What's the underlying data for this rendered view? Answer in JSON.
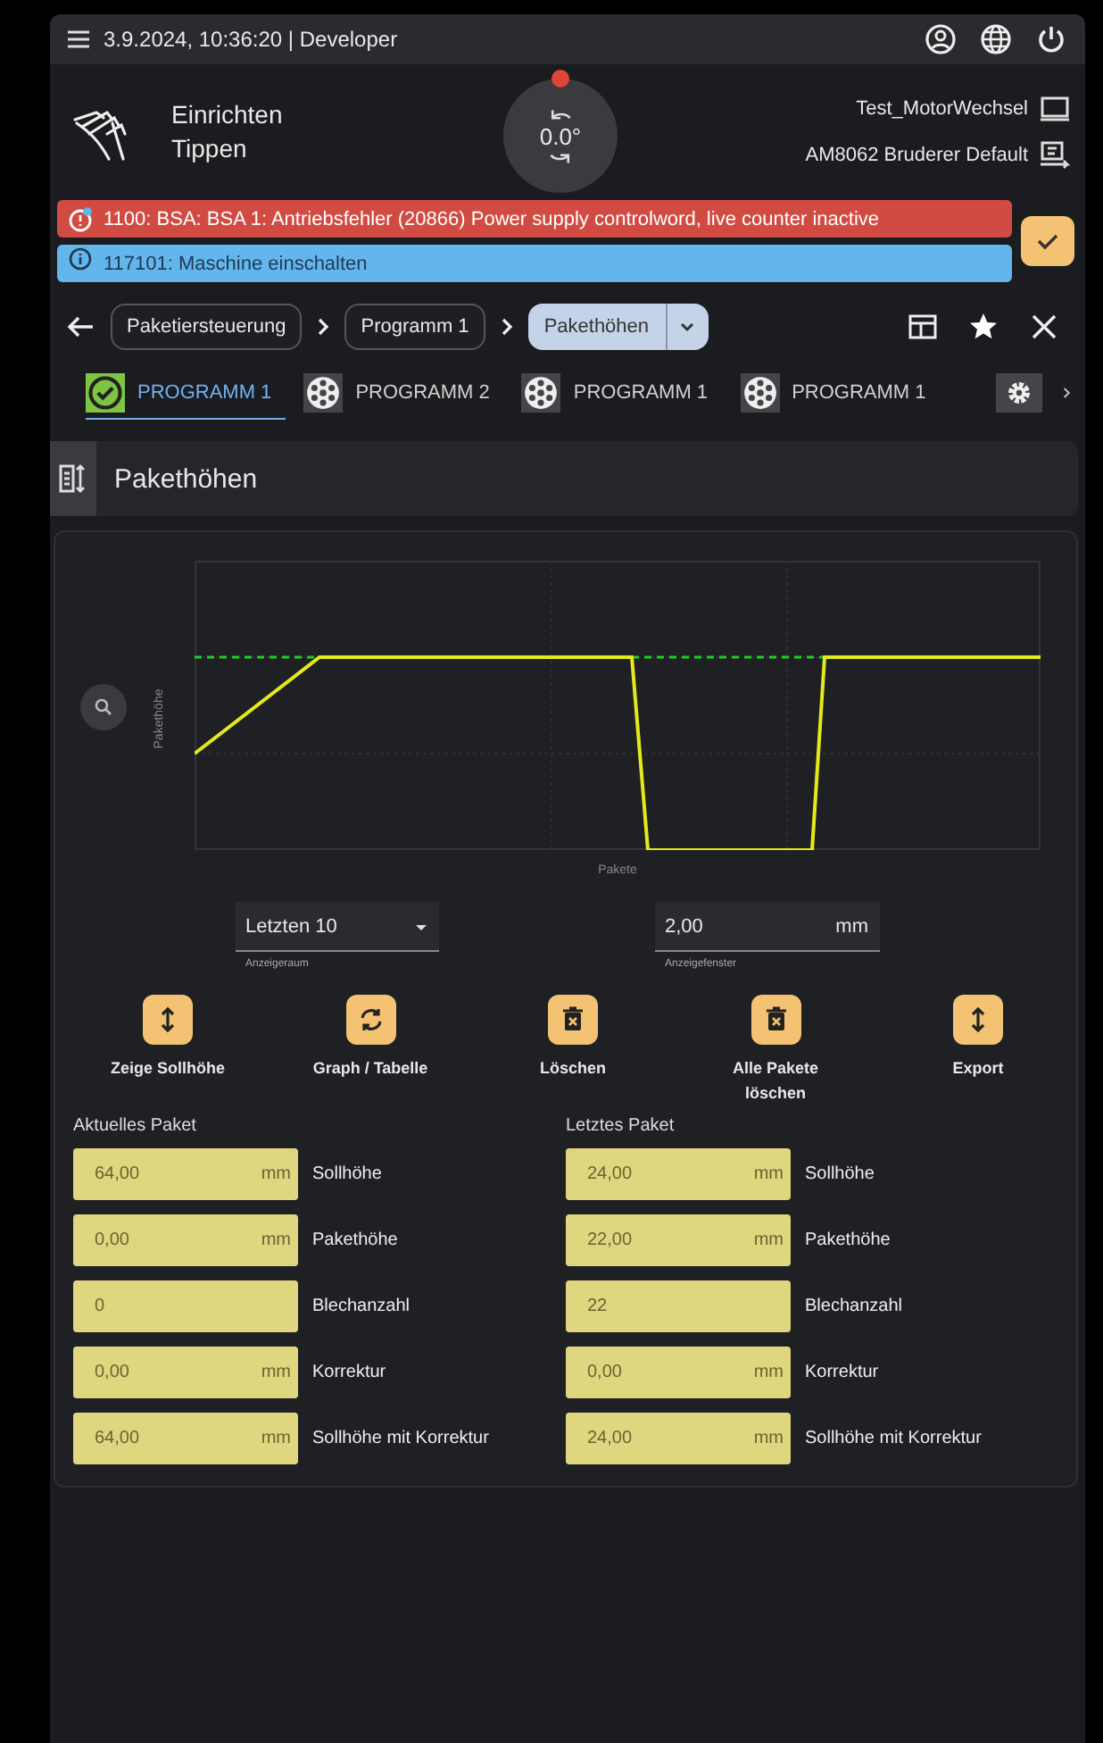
{
  "top_bar": {
    "status_text": "3.9.2024, 10:36:20 | Developer"
  },
  "mode": {
    "lines": [
      "Einrichten",
      "Tippen"
    ]
  },
  "dial": {
    "value": "0.0°"
  },
  "machine": [
    {
      "label": "Test_MotorWechsel",
      "kind": "monitor"
    },
    {
      "label": "AM8062 Bruderer Default",
      "kind": "output"
    }
  ],
  "messages": [
    {
      "kind": "error",
      "text": "1100: BSA: BSA 1: Antriebsfehler (20866) Power supply controlword, live counter inactive"
    },
    {
      "kind": "info",
      "text": "117101: Maschine einschalten"
    }
  ],
  "breadcrumbs": [
    {
      "label": "Paketiersteuerung",
      "selected": false
    },
    {
      "label": "Programm 1",
      "selected": false
    },
    {
      "label": "Pakethöhen",
      "selected": true
    }
  ],
  "tabs": [
    {
      "label": "PROGRAMM 1",
      "selected": true
    },
    {
      "label": "PROGRAMM 2",
      "selected": false
    },
    {
      "label": "PROGRAMM 1",
      "selected": false
    },
    {
      "label": "PROGRAMM 1",
      "selected": false
    }
  ],
  "section": {
    "title": "Pakethöhen"
  },
  "chart": {
    "ylabel": "Pakethöhe",
    "xlabel": "Pakete"
  },
  "range_select": {
    "value": "Letzten 10",
    "label": "Anzeigeraum"
  },
  "window_field": {
    "value": "2,00",
    "unit": "mm",
    "label": "Anzeigefenster"
  },
  "actions": [
    {
      "kind": "height",
      "label": "Zeige Sollhöhe"
    },
    {
      "kind": "swap",
      "label": "Graph / Tabelle"
    },
    {
      "kind": "delete",
      "label": "Löschen"
    },
    {
      "kind": "delete",
      "label": "Alle Pakete löschen"
    },
    {
      "kind": "height",
      "label": "Export"
    }
  ],
  "panels": [
    {
      "title": "Aktuelles Paket",
      "rows": [
        {
          "value": "64,00",
          "unit": "mm",
          "label": "Sollhöhe"
        },
        {
          "value": "0,00",
          "unit": "mm",
          "label": "Pakethöhe"
        },
        {
          "value": "0",
          "label": "Blechanzahl"
        },
        {
          "value": "0,00",
          "unit": "mm",
          "label": "Korrektur"
        },
        {
          "value": "64,00",
          "unit": "mm",
          "label": "Sollhöhe mit Korrektur"
        }
      ]
    },
    {
      "title": "Letztes Paket",
      "rows": [
        {
          "value": "24,00",
          "unit": "mm",
          "label": "Sollhöhe"
        },
        {
          "value": "22,00",
          "unit": "mm",
          "label": "Pakethöhe"
        },
        {
          "value": "22",
          "label": "Blechanzahl"
        },
        {
          "value": "0,00",
          "unit": "mm",
          "label": "Korrektur"
        },
        {
          "value": "24,00",
          "unit": "mm",
          "label": "Sollhöhe mit Korrektur"
        }
      ]
    }
  ]
}
